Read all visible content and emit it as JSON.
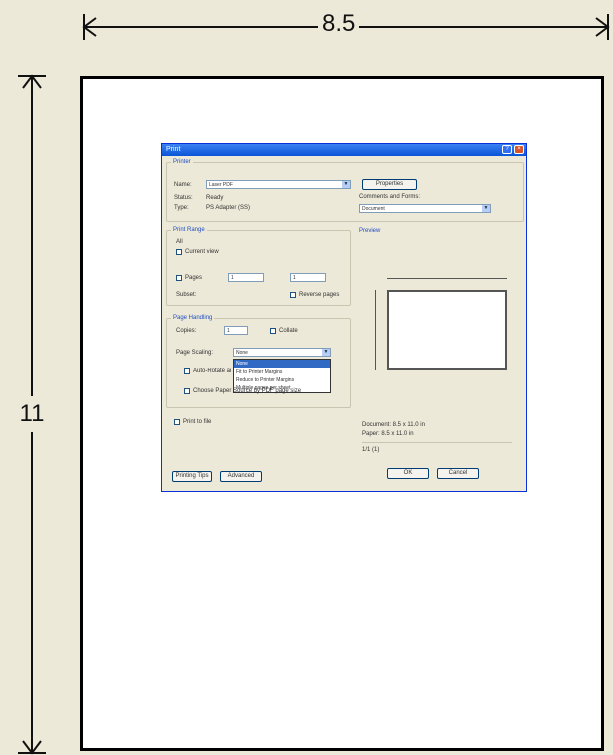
{
  "dimensions": {
    "width_label": "8.5",
    "height_label": "11"
  },
  "dialog": {
    "title": "Print",
    "printer_group": "Printer",
    "name_label": "Name:",
    "name_value": "Laser PDF",
    "properties_button": "Properties",
    "status_label": "Status:",
    "status_value": "Ready",
    "type_label": "Type:",
    "type_value": "PS Adapter (SS)",
    "comments_label": "Comments and Forms:",
    "comments_value": "Document",
    "print_range_group": "Print Range",
    "all_label": "All",
    "current_view_label": "Current view",
    "pages_label": "Pages",
    "pages_from": "1",
    "pages_to": "1",
    "subset_label": "Subset:",
    "reverse_label": "Reverse pages",
    "page_handling_group": "Page Handling",
    "copies_label": "Copies:",
    "copies_value": "1",
    "collate_label": "Collate",
    "page_scaling_label": "Page Scaling:",
    "page_scaling_value": "None",
    "scaling_options": [
      "None",
      "Fit to Printer Margins",
      "Reduce to Printer Margins",
      "Multiple pages per sheet"
    ],
    "auto_rotate_label": "Auto-Rotate and Center",
    "choose_paper_label": "Choose Paper Source by PDF page size",
    "print_to_file_label": "Print to file",
    "preview_label": "Preview",
    "document_info": "Document: 8.5 x 11.0 in",
    "paper_info": "Paper: 8.5 x 11.0 in",
    "pages_info": "1/1 (1)",
    "printing_tips_button": "Printing Tips",
    "advanced_button": "Advanced",
    "ok_button": "OK",
    "cancel_button": "Cancel"
  }
}
